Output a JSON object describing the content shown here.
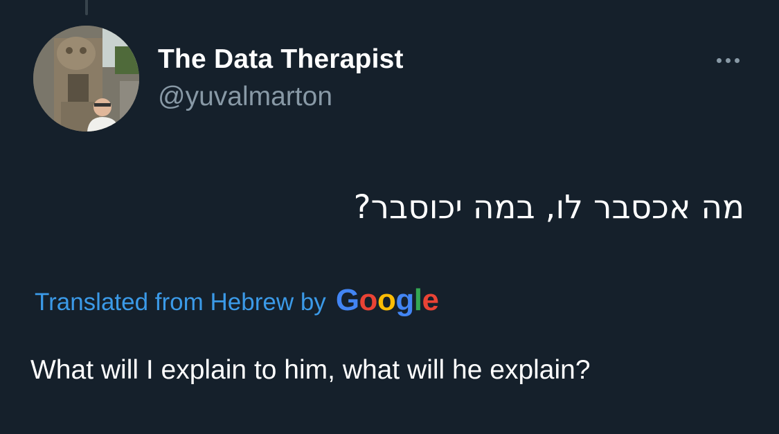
{
  "tweet": {
    "display_name": "The Data Therapist",
    "handle": "@yuvalmarton",
    "original_text": "מה אכסבר לו, במה יכוסבר?",
    "translation_label": "Translated from Hebrew by",
    "translation_provider": {
      "letters": [
        "G",
        "o",
        "o",
        "g",
        "l",
        "e"
      ],
      "colors": [
        "#4285f4",
        "#ea4335",
        "#fbbc05",
        "#4285f4",
        "#34a853",
        "#ea4335"
      ]
    },
    "translated_text": "What will I explain to him, what will he explain?",
    "more_icon": "more-dots-icon"
  },
  "colors": {
    "background": "#15202b",
    "primary_text": "#ffffff",
    "secondary_text": "#8899a6",
    "link": "#3b9ae8"
  }
}
